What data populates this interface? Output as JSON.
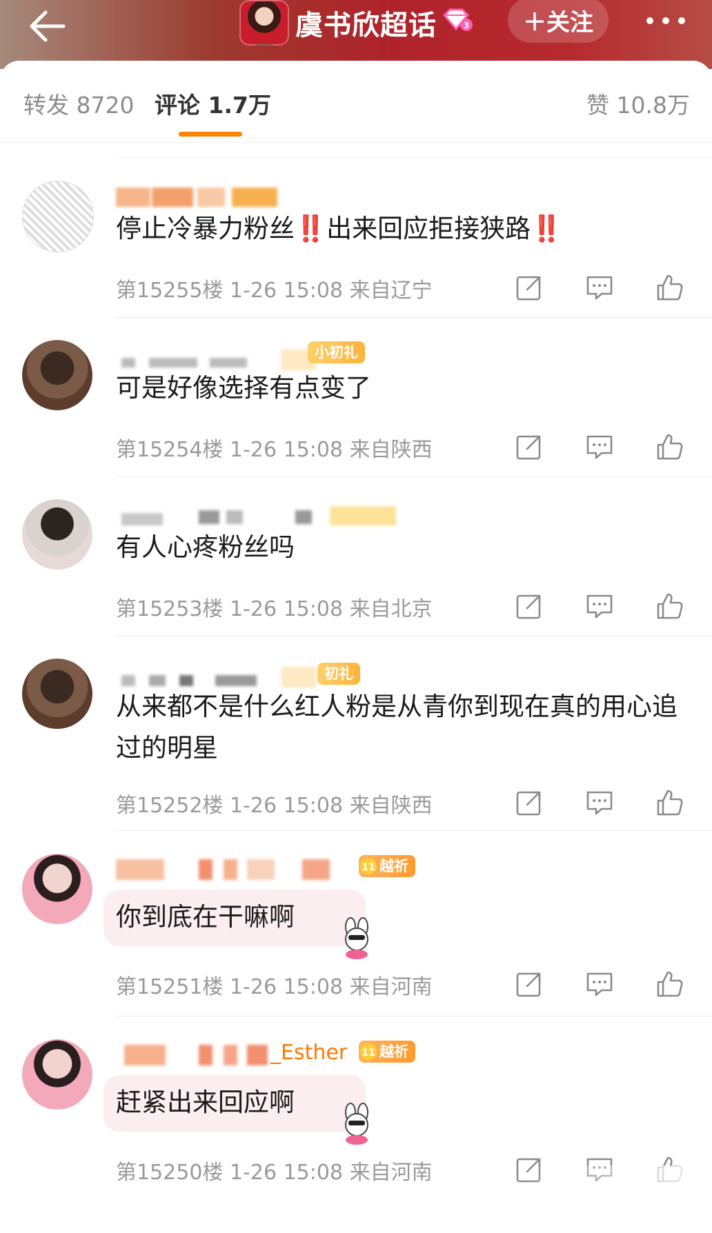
{
  "header": {
    "title": "虞书欣超话",
    "follow_label": "＋关注",
    "accent": "#b0232b"
  },
  "tabs": {
    "repost": "转发 8720",
    "comments": "评论 1.7万",
    "likes": "赞 10.8万",
    "underline_color": "#ff8200"
  },
  "comments": [
    {
      "text_a": "停止冷暴力粉丝",
      "mark1": "‼️",
      "text_b": "出来回应拒接狭路",
      "mark2": "‼️",
      "meta": "第15255楼 1-26 15:08 来自辽宁"
    },
    {
      "badge": "小初礼",
      "text": "可是好像选择有点变了",
      "meta": "第15254楼 1-26 15:08 来自陕西"
    },
    {
      "text": "有人心疼粉丝吗",
      "meta": "第15253楼 1-26 15:08 来自北京"
    },
    {
      "badge": "初礼",
      "text": "从来都不是什么红人粉是从青你到现在真的用心追过的明星",
      "meta": "第15252楼 1-26 15:08 来自陕西"
    },
    {
      "badge": "越祈",
      "text": "你到底在干嘛啊",
      "meta": "第15251楼 1-26 15:08 来自河南"
    },
    {
      "username_fragment": "_Esther",
      "badge": "越祈",
      "text": "赶紧出来回应啊",
      "meta": "第15250楼 1-26 15:08 来自河南"
    }
  ]
}
